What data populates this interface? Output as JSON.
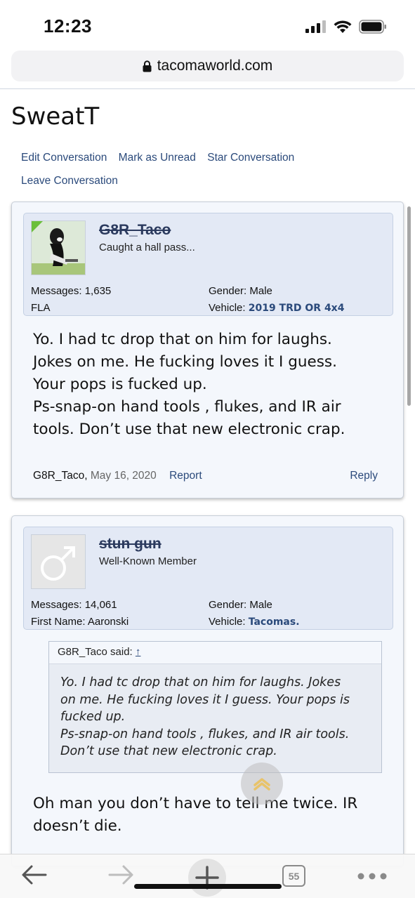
{
  "status": {
    "time": "12:23"
  },
  "browser": {
    "url": "tacomaworld.com",
    "tab_count": "55"
  },
  "conversation": {
    "title": "SweatT",
    "actions": [
      "Edit Conversation",
      "Mark as Unread",
      "Star Conversation",
      "Leave Conversation"
    ]
  },
  "messages": [
    {
      "username": "G8R_Taco",
      "user_title": "Caught a hall pass...",
      "messages_label": "Messages:",
      "messages_value": "1,635",
      "location": "FLA",
      "gender_label": "Gender:",
      "gender_value": "Male",
      "vehicle_label": "Vehicle:",
      "vehicle_value": "2019 TRD OR 4x4",
      "body": [
        "Yo. I had tc drop that on him for laughs.",
        "Jokes on me. He fucking loves it I guess.",
        "Your pops is fucked up.",
        "Ps-snap-on hand tools , flukes, and IR air",
        "tools. Don’t use that new electronic crap."
      ],
      "author": "G8R_Taco,",
      "date": "May 16, 2020",
      "report": "Report",
      "reply": "Reply"
    },
    {
      "username": "stun gun",
      "user_title": "Well-Known Member",
      "messages_label": "Messages:",
      "messages_value": "14,061",
      "first_name_label": "First Name:",
      "first_name_value": "Aaronski",
      "gender_label": "Gender:",
      "gender_value": "Male",
      "vehicle_label": "Vehicle:",
      "vehicle_value": "Tacomas.",
      "quote_author": "G8R_Taco said:",
      "quote_arrow": "↑",
      "quote_lines": [
        "Yo. I had tc drop that on him for laughs. Jokes",
        "on me. He fucking loves it I guess. Your pops is",
        "fucked up.",
        "Ps-snap-on hand tools , flukes, and IR air tools.",
        "Don’t use that new electronic crap."
      ],
      "body": [
        "Oh man you don’t have to tell me twice. IR",
        "doesn’t die."
      ]
    }
  ],
  "icons": {
    "back": "back-arrow-icon",
    "forward": "forward-arrow-icon",
    "new_tab": "plus-icon",
    "tabs": "tabs-icon",
    "more": "more-icon",
    "lock": "lock-icon",
    "scroll_top": "chevron-up-icon"
  }
}
